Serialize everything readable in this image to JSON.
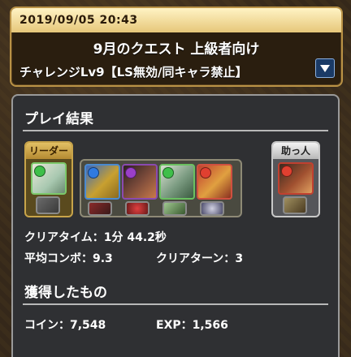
{
  "quest": {
    "date": "2019/09/05 20:43",
    "title": "9月のクエスト 上級者向け",
    "subtitle": "チャレンジLv9【LS無効/同キャラ禁止】"
  },
  "result": {
    "section_title": "プレイ結果",
    "leader_label": "リーダー",
    "helper_label": "助っ人",
    "clear_time_label": "クリアタイム：",
    "clear_time_value": "1分 44.2秒",
    "avg_combo_label": "平均コンボ：",
    "avg_combo_value": "9.3",
    "clear_turns_label": "クリアターン：",
    "clear_turns_value": "3"
  },
  "rewards": {
    "section_title": "獲得したもの",
    "coin_label": "コイン：",
    "coin_value": "7,548",
    "exp_label": "EXP：",
    "exp_value": "1,566"
  },
  "colors": {
    "banner_border": "#b99246",
    "panel_bg": "#2f3033",
    "leader_frame": "#c8a44a",
    "helper_frame": "#c8c8c8"
  },
  "team": {
    "leader": {
      "icon": "monster-portrait",
      "attr": "wood"
    },
    "subs": [
      {
        "icon": "monster-portrait",
        "attr": "blue"
      },
      {
        "icon": "monster-portrait",
        "attr": "dark"
      },
      {
        "icon": "monster-portrait",
        "attr": "wood"
      },
      {
        "icon": "monster-portrait",
        "attr": "red"
      }
    ],
    "helper": {
      "icon": "monster-portrait",
      "attr": "red"
    }
  }
}
